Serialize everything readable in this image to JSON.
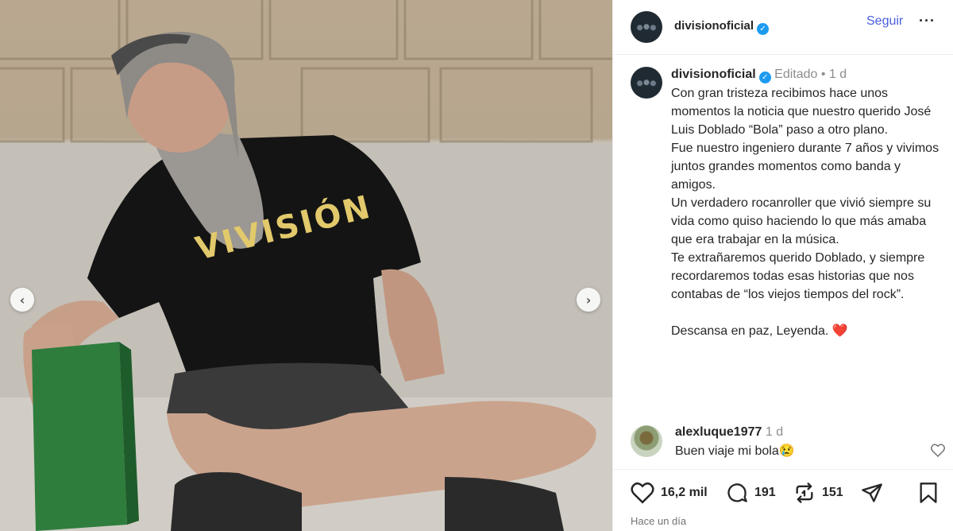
{
  "post": {
    "shirt_text": "VIVISIÓN",
    "nav_prev": "‹",
    "nav_next": "›"
  },
  "header": {
    "username": "divisionoficial",
    "verified_icon": "verified-badge-icon",
    "follow_label": "Seguir",
    "more_label": "···"
  },
  "caption": {
    "username": "divisionoficial",
    "edited": "Editado",
    "separator": "•",
    "time": "1 d",
    "text": "Con gran tristeza recibimos hace unos momentos la noticia que nuestro querido José Luis Doblado “Bola” paso a otro plano.\nFue nuestro ingeniero durante 7 años y vivimos juntos grandes momentos como banda y amigos.\nUn verdadero rocanroller que vivió siempre su vida como quiso haciendo lo que más amaba que era trabajar en la música.\nTe extrañaremos querido Doblado, y siempre recordaremos todas esas historias que nos contabas de “los viejos tiempos del rock”.\n\nDescansa en paz, Leyenda. ",
    "heart": "❤️"
  },
  "comment": {
    "username": "alexluque1977",
    "time": "1 d",
    "text": "Buen viaje mi bola😢"
  },
  "actions": {
    "likes": "16,2 mil",
    "comments": "191",
    "reposts": "151",
    "posted": "Hace un día"
  },
  "colors": {
    "accent": "#4a5de0",
    "verified": "#1d9bf0",
    "heart": "#e0245e"
  }
}
